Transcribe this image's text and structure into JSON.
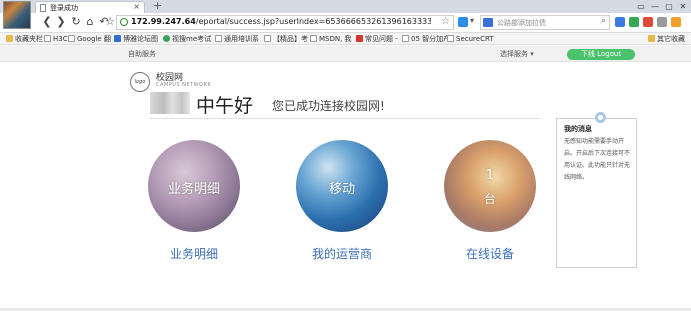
{
  "browser": {
    "tab_title": "登录成功",
    "tab_close": "×",
    "new_tab": "+",
    "address": {
      "host": "172.99.247.64",
      "path": "/eportal/success.jsp?userIndex=6536666532613961633333383"
    },
    "search_placeholder": "公路部添加拉债",
    "window_controls": [
      "▭",
      "—",
      "▢",
      "✕"
    ]
  },
  "bookmarks": [
    {
      "label": "收藏夹栏",
      "kind": "folder"
    },
    {
      "label": "H3C",
      "kind": "page"
    },
    {
      "label": "Google 翻",
      "kind": "page"
    },
    {
      "label": "博雅论坛图",
      "kind": "blue"
    },
    {
      "label": "视搜me考试",
      "kind": "green"
    },
    {
      "label": "通用培训系",
      "kind": "page"
    },
    {
      "label": "【精品】考",
      "kind": "page"
    },
    {
      "label": "MSDN, 我",
      "kind": "page"
    },
    {
      "label": "常见问题 -",
      "kind": "red"
    },
    {
      "label": "05 智分加产",
      "kind": "page"
    },
    {
      "label": "SecureCRT",
      "kind": "page"
    },
    {
      "label": "其它收藏",
      "kind": "folder"
    }
  ],
  "portal": {
    "self_service": "自助服务",
    "select_service": "选择服务",
    "logout": "下线 Logout"
  },
  "campus": {
    "logo_text": "logo",
    "name_cn": "校园网",
    "name_en": "CAMPUS NETWORK"
  },
  "greeting": {
    "salutation": "中午好",
    "message": "您已成功连接校园网!"
  },
  "tiles": [
    {
      "circle_text": "业务明细",
      "link": "业务明细"
    },
    {
      "circle_text": "移动",
      "link": "我的运营商"
    },
    {
      "count": "1",
      "unit": "台",
      "link": "在线设备"
    }
  ],
  "messages": {
    "title": "我的消息",
    "body": "无感知功能需要手动开启。开启后下次连接可不用认证。此功能只针对无线网络。"
  }
}
